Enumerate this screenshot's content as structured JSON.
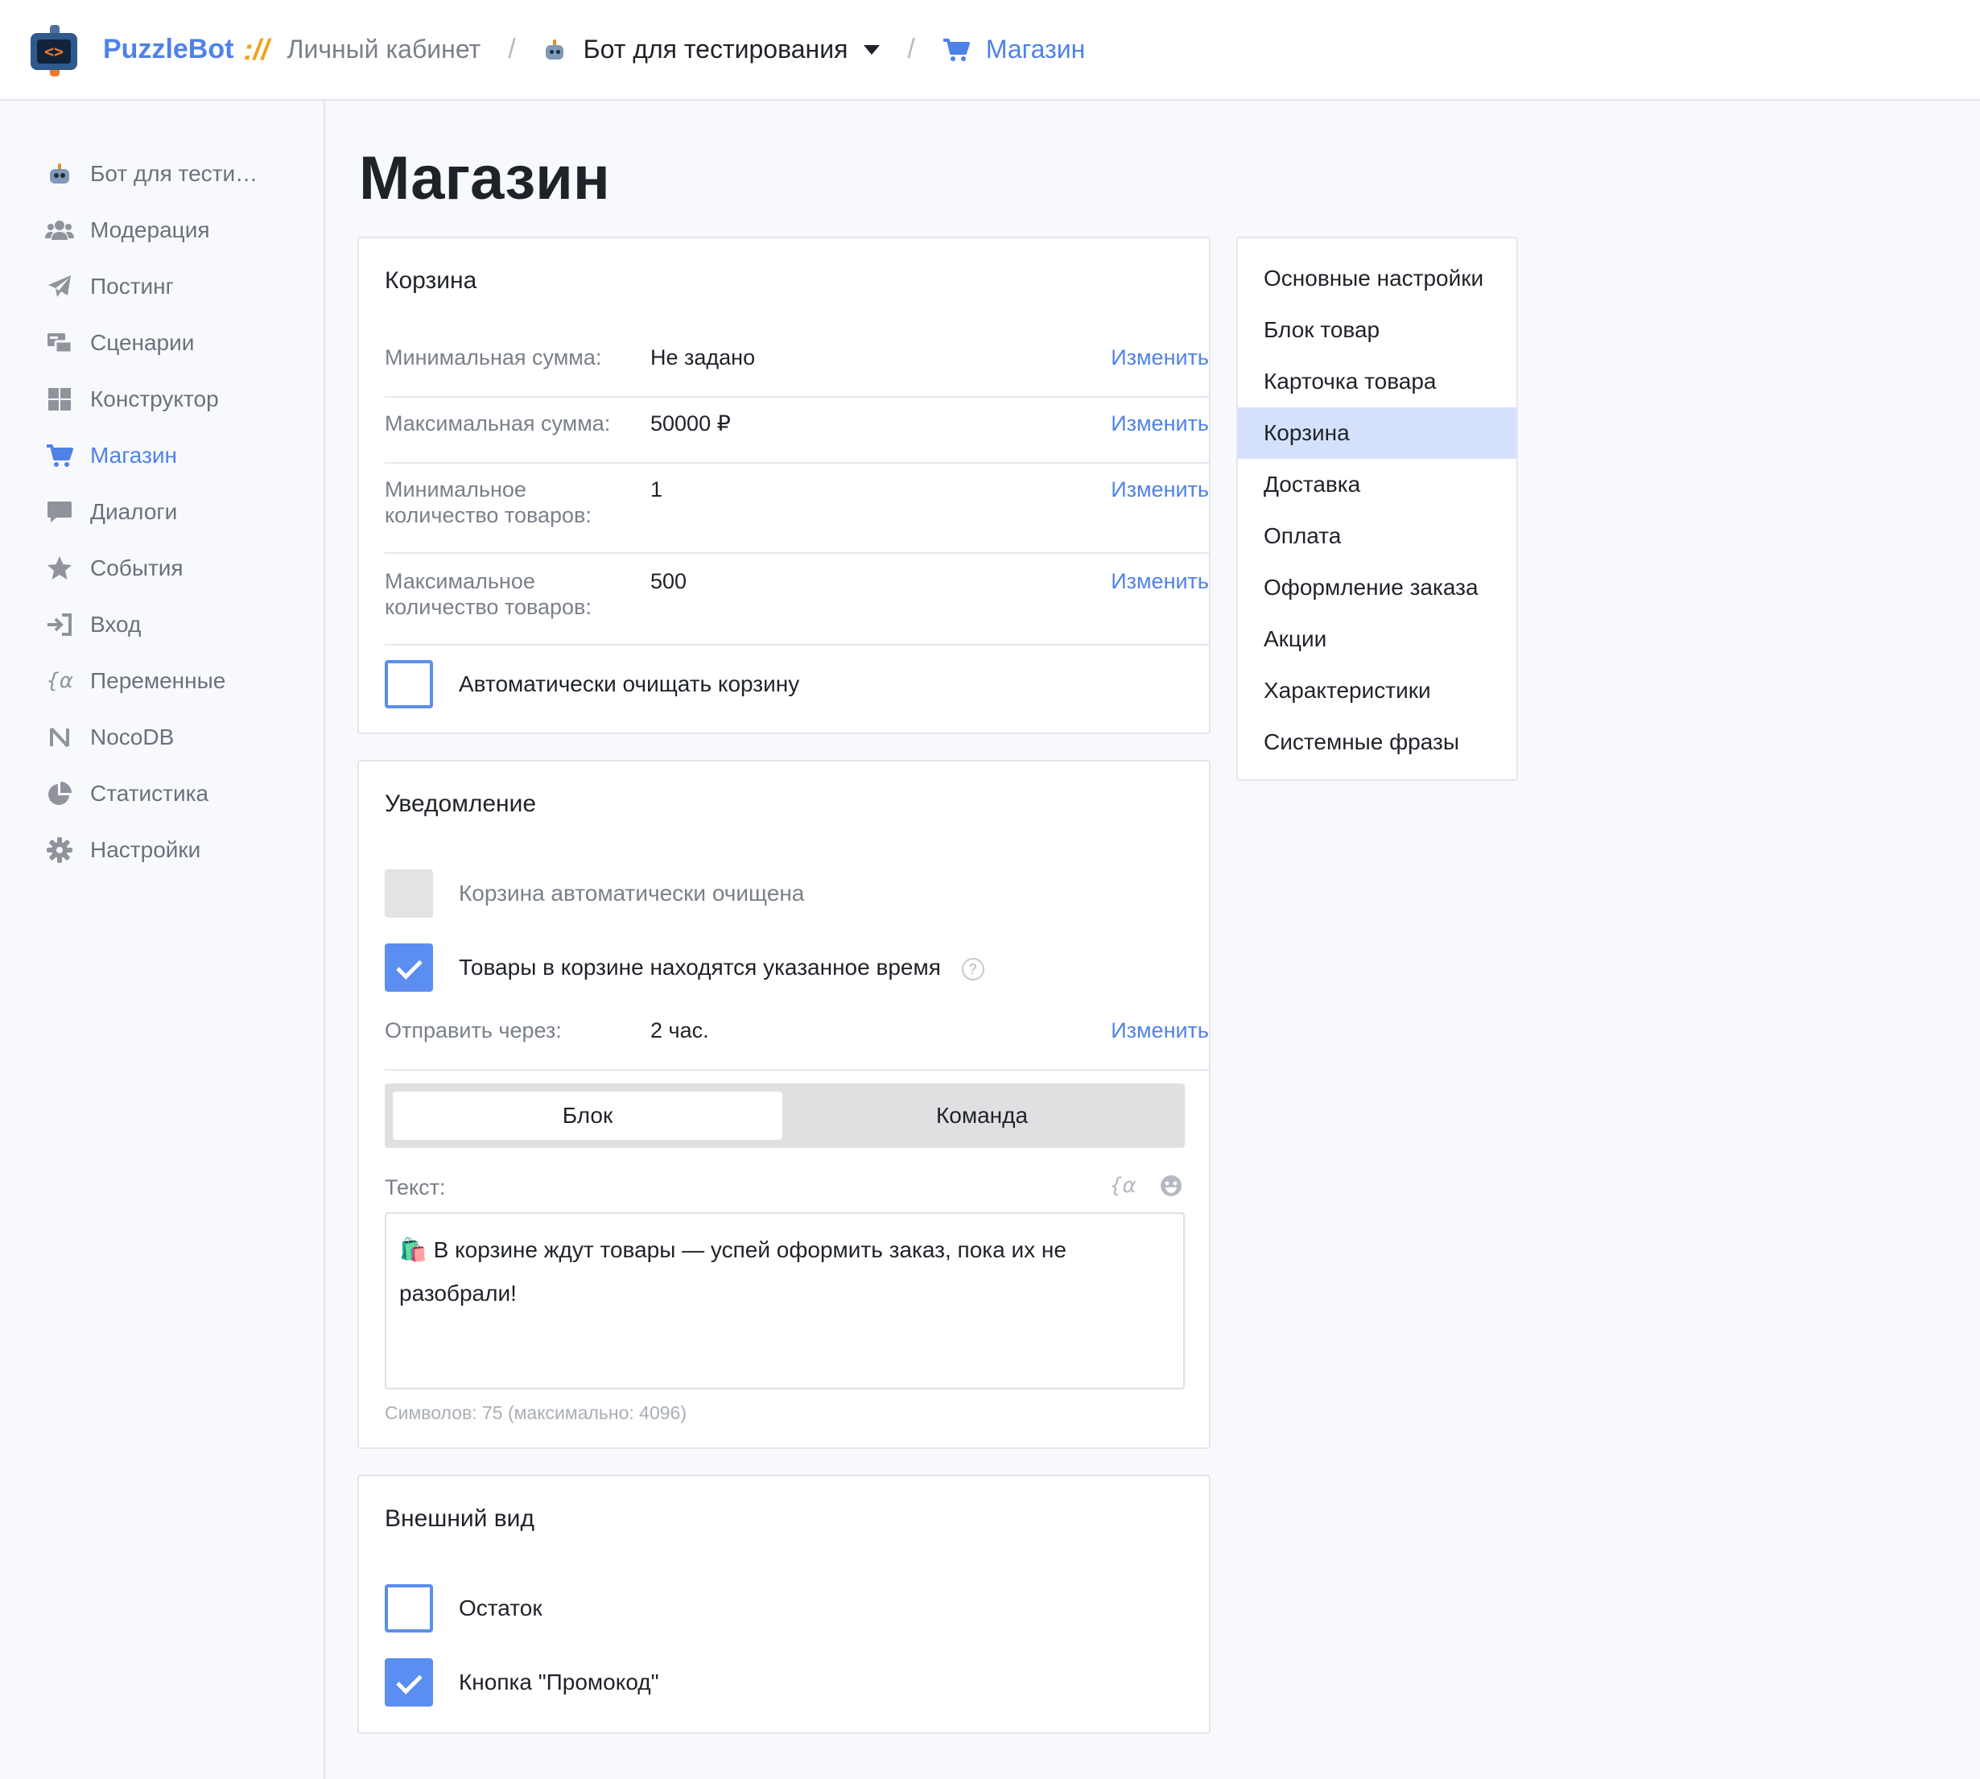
{
  "header": {
    "brand": "PuzzleBot",
    "brand_separator": "://",
    "breadcrumb_cabinet": "Личный кабинет",
    "breadcrumb_bot": "Бот для тестирования",
    "breadcrumb_shop": "Магазин"
  },
  "sidebar": {
    "items": [
      {
        "label": "Бот для тести…",
        "icon": "bot-icon"
      },
      {
        "label": "Модерация",
        "icon": "users-icon"
      },
      {
        "label": "Постинг",
        "icon": "paper-plane-icon"
      },
      {
        "label": "Сценарии",
        "icon": "scenarios-icon"
      },
      {
        "label": "Конструктор",
        "icon": "grid-icon"
      },
      {
        "label": "Магазин",
        "icon": "cart-icon"
      },
      {
        "label": "Диалоги",
        "icon": "chat-icon"
      },
      {
        "label": "События",
        "icon": "star-icon"
      },
      {
        "label": "Вход",
        "icon": "sign-in-icon"
      },
      {
        "label": "Переменные",
        "icon": "variable-icon"
      },
      {
        "label": "NocoDB",
        "icon": "nocodb-icon"
      },
      {
        "label": "Статистика",
        "icon": "pie-chart-icon"
      },
      {
        "label": "Настройки",
        "icon": "gear-icon"
      }
    ],
    "active_index": 5
  },
  "page": {
    "title": "Магазин"
  },
  "cart_card": {
    "title": "Корзина",
    "rows": [
      {
        "label": "Минимальная сумма:",
        "value": "Не задано",
        "action": "Изменить"
      },
      {
        "label": "Максимальная сумма:",
        "value": "50000 ₽",
        "action": "Изменить"
      },
      {
        "label": "Минимальное количество товаров:",
        "value": "1",
        "action": "Изменить"
      },
      {
        "label": "Максимальное количество товаров:",
        "value": "500",
        "action": "Изменить"
      }
    ],
    "auto_clear": {
      "label": "Автоматически очищать корзину",
      "checked": false
    }
  },
  "notify_card": {
    "title": "Уведомление",
    "option_cleared": {
      "label": "Корзина автоматически очищена",
      "checked": false,
      "disabled": true
    },
    "option_time": {
      "label": "Товары в корзине находятся указанное время",
      "checked": true,
      "help": "?"
    },
    "send_after": {
      "label": "Отправить через:",
      "value": "2 час.",
      "action": "Изменить"
    },
    "segment": {
      "options": [
        "Блок",
        "Команда"
      ],
      "active_index": 0
    },
    "text_label": "Текст:",
    "text_value_line1": "🛍️ В корзине ждут товары — успей оформить заказ, пока их не",
    "text_value_line2": "разобрали!",
    "counter": "Символов: 75 (максимально: 4096)"
  },
  "look_card": {
    "title": "Внешний вид",
    "option_rest": {
      "label": "Остаток",
      "checked": false
    },
    "option_promo": {
      "label": "Кнопка \"Промокод\"",
      "checked": true
    }
  },
  "right_nav": {
    "items": [
      "Основные настройки",
      "Блок товар",
      "Карточка товара",
      "Корзина",
      "Доставка",
      "Оплата",
      "Оформление заказа",
      "Акции",
      "Характеристики",
      "Системные фразы"
    ],
    "active_index": 3
  },
  "colors": {
    "accent": "#4f82e8",
    "checkbox": "#5b8ef0",
    "active_nav_bg": "#d5e1fb",
    "brand_separator": "#f0a31c"
  }
}
